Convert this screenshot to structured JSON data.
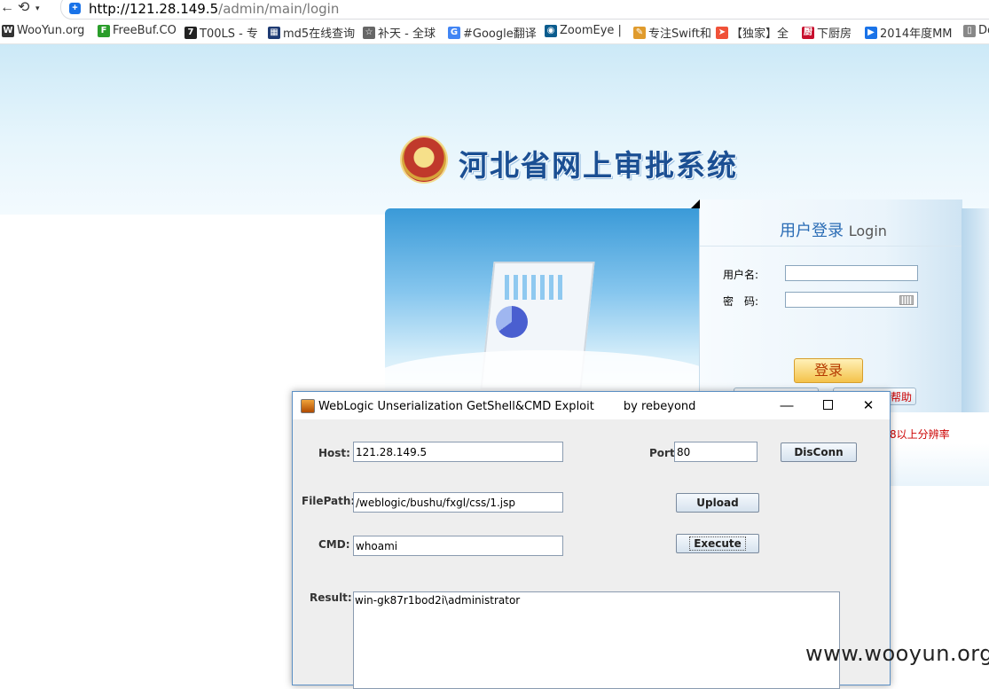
{
  "browser": {
    "url_host": "http://121.28.149.5",
    "url_path": "/admin/main/login",
    "bookmarks": [
      {
        "label": "WooYun.org",
        "icon": "wooyun-icon",
        "color": "#333333"
      },
      {
        "label": "FreeBuf.CO",
        "icon": "freebuf-icon",
        "color": "#2a9d2a"
      },
      {
        "label": "T00LS - 专",
        "icon": "tools-icon",
        "color": "#222222"
      },
      {
        "label": "md5在线查询",
        "icon": "grid-icon",
        "color": "#1f3b73"
      },
      {
        "label": "补天 - 全球",
        "icon": "star-icon",
        "color": "#666666"
      },
      {
        "label": "#Google翻译",
        "icon": "translate-icon",
        "color": "#4285f4"
      },
      {
        "label": "ZoomEye |",
        "icon": "zoomeye-icon",
        "color": "#0b5c8e"
      },
      {
        "label": "专注Swift和",
        "icon": "pen-icon",
        "color": "#e09b2d"
      },
      {
        "label": "【独家】全",
        "icon": "swift-icon",
        "color": "#f05138"
      },
      {
        "label": "下厨房",
        "icon": "kitchen-icon",
        "color": "#c8102e"
      },
      {
        "label": "2014年度MM",
        "icon": "play-icon",
        "color": "#1a73e8"
      },
      {
        "label": "Do",
        "icon": "document-icon",
        "color": "#888888"
      }
    ]
  },
  "page": {
    "site_title": "河北省网上审批系统",
    "login": {
      "title_cn": "用户登录",
      "title_en": "Login",
      "username_label": "用户名:",
      "password_label": "密　码:",
      "submit_label": "登录",
      "help_label": "帮助"
    },
    "resolution_note": "8以上分辨率"
  },
  "dialog": {
    "title": "WebLogic Unserialization GetShell&CMD Exploit        by rebeyond",
    "host_label": "Host:",
    "host_value": "121.28.149.5",
    "port_label": "Port:",
    "port_value": "80",
    "disconn_label": "DisConn",
    "filepath_label": "FilePath:",
    "filepath_value": "/weblogic/bushu/fxgl/css/1.jsp",
    "upload_label": "Upload",
    "cmd_label": "CMD:",
    "cmd_value": "whoami",
    "execute_label": "Execute",
    "result_label": "Result:",
    "result_value": "win-gk87r1bod2i\\administrator"
  },
  "watermark": "www.wooyun.org",
  "colors": {
    "accent": "#1b4f93",
    "dialog_border": "#5b8fc4",
    "alert": "#cc0000"
  }
}
